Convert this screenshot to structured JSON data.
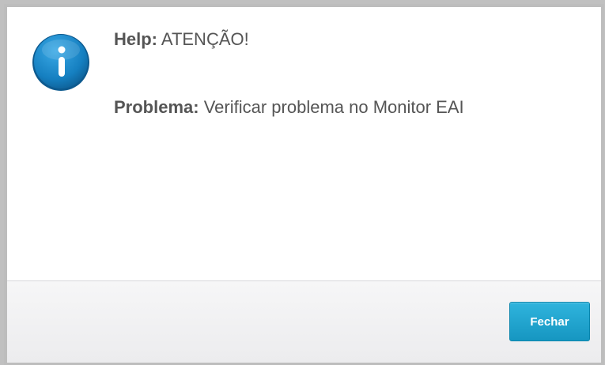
{
  "dialog": {
    "icon": "info-icon",
    "help_label": "Help:",
    "help_value": "ATENÇÃO!",
    "problem_label": "Problema:",
    "problem_value": "Verificar problema no Monitor EAI",
    "close_label": "Fechar"
  },
  "colors": {
    "icon_blue": "#1a88c9",
    "button_blue": "#1ea5d1",
    "text": "#555555"
  }
}
